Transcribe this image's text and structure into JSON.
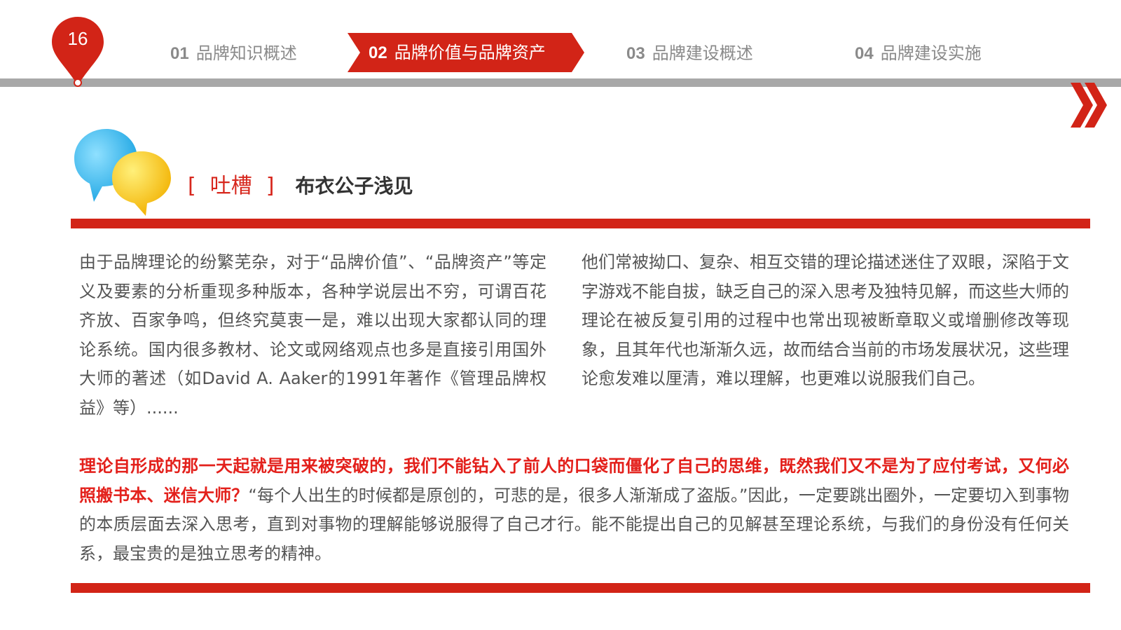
{
  "page": {
    "number": "16"
  },
  "nav": {
    "items": [
      {
        "num": "01",
        "label": "品牌知识概述"
      },
      {
        "num": "02",
        "label": "品牌价值与品牌资产"
      },
      {
        "num": "03",
        "label": "品牌建设概述"
      },
      {
        "num": "04",
        "label": "品牌建设实施"
      }
    ],
    "active_index": 1
  },
  "heading": {
    "bracket_open": "[",
    "tag": "吐槽",
    "bracket_close": "]",
    "subtitle": "布衣公子浅见"
  },
  "body": {
    "left": "由于品牌理论的纷繁芜杂，对于“品牌价值”、“品牌资产”等定义及要素的分析重现多种版本，各种学说层出不穷，可谓百花齐放、百家争鸣，但终究莫衷一是，难以出现大家都认同的理论系统。国内很多教材、论文或网络观点也多是直接引用国外大师的著述（如David A. Aaker的1991年著作《管理品牌权益》等）......",
    "right": "他们常被拗口、复杂、相互交错的理论描述迷住了双眼，深陷于文字游戏不能自拔，缺乏自己的深入思考及独特见解，而这些大师的理论在被反复引用的过程中也常出现被断章取义或增删修改等现象，且其年代也渐渐久远，故而结合当前的市场发展状况，这些理论愈发难以厘清，难以理解，也更难以说服我们自己。",
    "emphasis": "理论自形成的那一天起就是用来被突破的，我们不能钻入了前人的口袋而僵化了自己的思维，既然我们又不是为了应付考试，又何必照搬书本、迷信大师？",
    "rest": "“每个人出生的时候都是原创的，可悲的是，很多人渐渐成了盗版。”因此，一定要跳出圈外，一定要切入到事物的本质层面去深入思考，直到对事物的理解能够说服得了自己才行。能不能提出自己的见解甚至理论系统，与我们的身份没有任何关系，最宝贵的是独立思考的精神。"
  },
  "colors": {
    "accent_red": "#d22417",
    "emphasis_red": "#e3201b",
    "nav_gray": "#a8a8a8",
    "text_gray": "#555555",
    "bubble_blue": "#29b6ea",
    "bubble_yellow": "#f7c21b"
  },
  "icons": {
    "page_badge": "map-pin-icon",
    "next": "double-chevron-right-icon",
    "speech": "speech-bubbles-icon"
  }
}
